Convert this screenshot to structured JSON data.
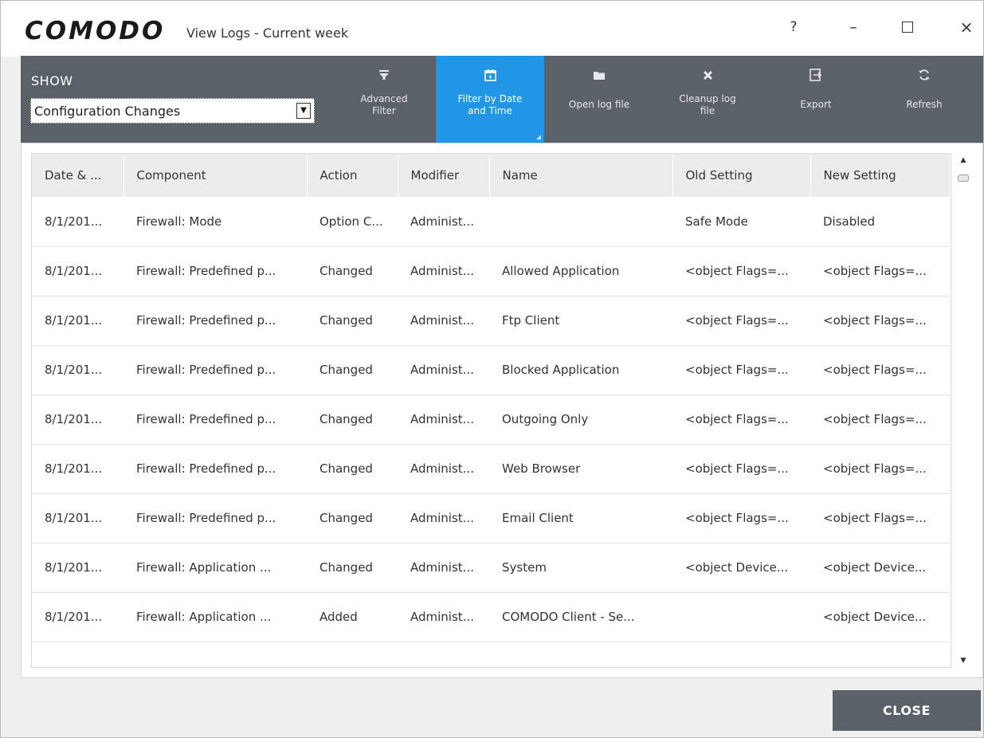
{
  "window": {
    "brand": "COMODO",
    "title": "View Logs - Current week",
    "controls": {
      "help": "?",
      "minimize": "–",
      "close": "×"
    }
  },
  "toolbar": {
    "show_label": "SHOW",
    "show_value": "Configuration Changes",
    "buttons": [
      {
        "label": "Advanced\nFilter",
        "icon": "filter-icon"
      },
      {
        "label": "Filter by Date\nand Time",
        "icon": "calendar-icon",
        "active": true
      },
      {
        "label": "Open log file",
        "icon": "folder-icon"
      },
      {
        "label": "Cleanup log\nfile",
        "icon": "clear-icon"
      },
      {
        "label": "Export",
        "icon": "export-icon"
      },
      {
        "label": "Refresh",
        "icon": "refresh-icon"
      }
    ],
    "active_color": "#2196e6",
    "bg_color": "#5b6169"
  },
  "table": {
    "columns": [
      "Date & ...",
      "Component",
      "Action",
      "Modifier",
      "Name",
      "Old Setting",
      "New Setting"
    ],
    "rows": [
      [
        "8/1/201...",
        "Firewall: Mode",
        "Option C...",
        "Administ...",
        "",
        "Safe Mode",
        "Disabled"
      ],
      [
        "8/1/201...",
        "Firewall: Predefined p...",
        "Changed",
        "Administ...",
        "Allowed Application",
        "<object Flags=...",
        "<object Flags=..."
      ],
      [
        "8/1/201...",
        "Firewall: Predefined p...",
        "Changed",
        "Administ...",
        "Ftp Client",
        "<object Flags=...",
        "<object Flags=..."
      ],
      [
        "8/1/201...",
        "Firewall: Predefined p...",
        "Changed",
        "Administ...",
        "Blocked Application",
        "<object Flags=...",
        "<object Flags=..."
      ],
      [
        "8/1/201...",
        "Firewall: Predefined p...",
        "Changed",
        "Administ...",
        "Outgoing Only",
        "<object Flags=...",
        "<object Flags=..."
      ],
      [
        "8/1/201...",
        "Firewall: Predefined p...",
        "Changed",
        "Administ...",
        "Web Browser",
        "<object Flags=...",
        "<object Flags=..."
      ],
      [
        "8/1/201...",
        "Firewall: Predefined p...",
        "Changed",
        "Administ...",
        "Email Client",
        "<object Flags=...",
        "<object Flags=..."
      ],
      [
        "8/1/201...",
        "Firewall: Application ...",
        "Changed",
        "Administ...",
        "System",
        "<object Device...",
        "<object Device..."
      ],
      [
        "8/1/201...",
        "Firewall: Application ...",
        "Added",
        "Administ...",
        "COMODO Client - Se...",
        "",
        "<object Device..."
      ]
    ]
  },
  "footer": {
    "close_label": "CLOSE"
  }
}
